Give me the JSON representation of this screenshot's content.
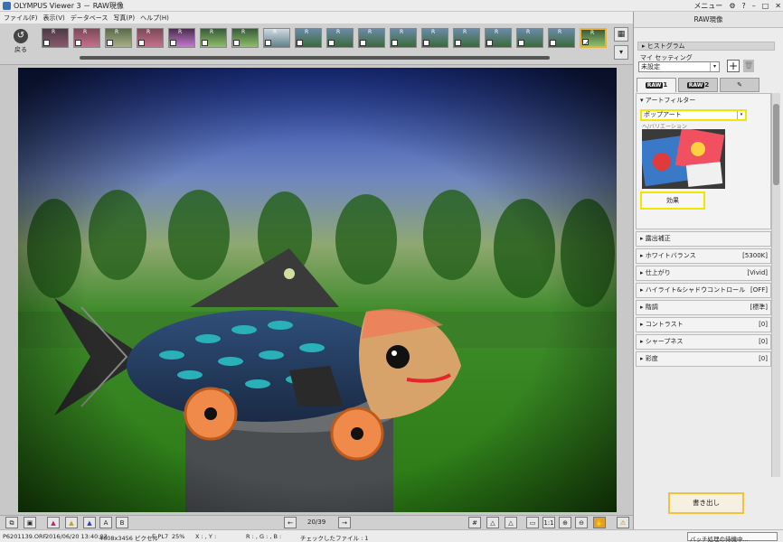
{
  "window": {
    "title": "OLYMPUS Viewer 3 － RAW現像",
    "menu_label": "メニュー",
    "controls": [
      "⚙",
      "?",
      "–",
      "□",
      "✕"
    ]
  },
  "menubar": [
    "ファイル(F)",
    "表示(V)",
    "データベース",
    "写真(P)",
    "ヘルプ(H)"
  ],
  "toolbar": {
    "back_label": "戻る",
    "thumbnails": [
      {
        "raw": "R"
      },
      {
        "raw": "R"
      },
      {
        "raw": "R"
      },
      {
        "raw": "R"
      },
      {
        "raw": "R"
      },
      {
        "raw": "R"
      },
      {
        "raw": "R"
      },
      {
        "raw": "R"
      },
      {
        "raw": "R"
      },
      {
        "raw": "R"
      },
      {
        "raw": "R"
      },
      {
        "raw": "R"
      },
      {
        "raw": "R"
      },
      {
        "raw": "R"
      },
      {
        "raw": "R"
      },
      {
        "raw": "R"
      },
      {
        "raw": "R"
      },
      {
        "raw": "R"
      }
    ]
  },
  "bottombar": {
    "counter": "20/39"
  },
  "statusbar": {
    "filename": "P6201139.ORF",
    "datetime": "2016/06/20 13:40:03",
    "dimensions": "4608x3456 ピクセル",
    "camera": "E-PL7",
    "zoom": "25%",
    "xy": "X : , Y :",
    "rgb": "R : , G : , B :",
    "checked": "チェックしたファイル : 1",
    "batch": "バッチ処理の待機中..."
  },
  "panel": {
    "title": "RAW現像",
    "histogram": "ヒストグラム",
    "my_setting_label": "マイ セッティング",
    "my_setting_value": "未設定",
    "tabs": [
      {
        "label": "1"
      },
      {
        "label": "2"
      }
    ],
    "sections": {
      "art_filter": {
        "label": "アートフィルター",
        "select": "ポップアート",
        "sub": "ヘ/バリエーション"
      },
      "effect_label": "効果",
      "exposure": {
        "label": "露出補正",
        "value": ""
      },
      "white_balance": {
        "label": "ホワイトバランス",
        "value": "[5300K]"
      },
      "finish": {
        "label": "仕上がり",
        "value": "[Vivid]"
      },
      "highlight_shadow": {
        "label": "ハイライト&シャドウコントロール",
        "value": "[OFF]"
      },
      "gradation": {
        "label": "階調",
        "value": "[標準]"
      },
      "contrast": {
        "label": "コントラスト",
        "value": "[0]"
      },
      "sharpness": {
        "label": "シャープネス",
        "value": "[0]"
      },
      "saturation": {
        "label": "彩度",
        "value": "[0]"
      }
    },
    "export_label": "書き出し"
  }
}
